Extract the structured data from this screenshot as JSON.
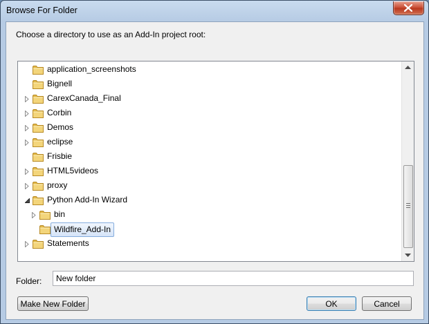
{
  "window": {
    "title": "Browse For Folder"
  },
  "instruction": "Choose a directory to use as an Add-In project root:",
  "tree": {
    "items": [
      {
        "label": "application_screenshots",
        "depth": 0,
        "expander": "none",
        "selected": false
      },
      {
        "label": "Bignell",
        "depth": 0,
        "expander": "none",
        "selected": false
      },
      {
        "label": "CarexCanada_Final",
        "depth": 0,
        "expander": "collapsed",
        "selected": false
      },
      {
        "label": "Corbin",
        "depth": 0,
        "expander": "collapsed",
        "selected": false
      },
      {
        "label": "Demos",
        "depth": 0,
        "expander": "collapsed",
        "selected": false
      },
      {
        "label": "eclipse",
        "depth": 0,
        "expander": "collapsed",
        "selected": false
      },
      {
        "label": "Frisbie",
        "depth": 0,
        "expander": "none",
        "selected": false
      },
      {
        "label": "HTML5videos",
        "depth": 0,
        "expander": "collapsed",
        "selected": false
      },
      {
        "label": "proxy",
        "depth": 0,
        "expander": "collapsed",
        "selected": false
      },
      {
        "label": "Python Add-In Wizard",
        "depth": 0,
        "expander": "expanded",
        "selected": false
      },
      {
        "label": "bin",
        "depth": 1,
        "expander": "collapsed",
        "selected": false
      },
      {
        "label": "Wildfire_Add-In",
        "depth": 1,
        "expander": "none",
        "selected": true
      },
      {
        "label": "Statements",
        "depth": 0,
        "expander": "collapsed",
        "selected": false
      }
    ]
  },
  "folder_field": {
    "label": "Folder:",
    "value": "New folder"
  },
  "buttons": {
    "make_new_folder": "Make New Folder",
    "ok": "OK",
    "cancel": "Cancel"
  },
  "icons": {
    "folder": "folder-icon",
    "close": "close-icon",
    "expander_collapsed": "chevron-right-icon",
    "expander_expanded": "chevron-down-icon",
    "scroll_up": "arrow-up-icon",
    "scroll_down": "arrow-down-icon"
  },
  "colors": {
    "folder": "#e8c35a",
    "selection": "#d5e4f8",
    "close_button": "#c74a31"
  }
}
